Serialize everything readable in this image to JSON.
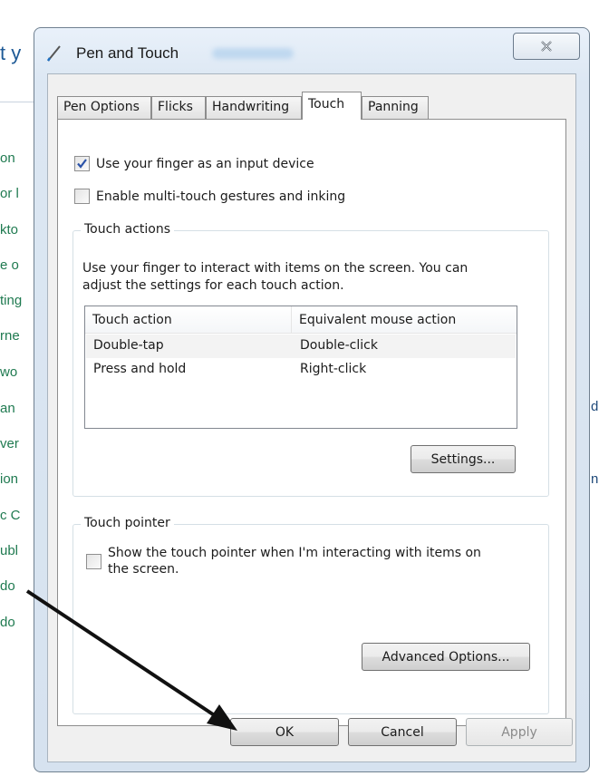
{
  "background": {
    "title_fragment": "t y",
    "links": [
      "on",
      "or l",
      "kto",
      "e o",
      "ting",
      "rne",
      "wo",
      " an",
      "ver",
      "ion",
      "c C",
      "ubl",
      "do",
      "do"
    ],
    "right_fragments": [
      "d",
      "n"
    ]
  },
  "dialog": {
    "title": "Pen and Touch",
    "tabs": [
      {
        "label": "Pen Options",
        "active": false
      },
      {
        "label": "Flicks",
        "active": false
      },
      {
        "label": "Handwriting",
        "active": false
      },
      {
        "label": "Touch",
        "active": true
      },
      {
        "label": "Panning",
        "active": false
      }
    ],
    "checkboxes": {
      "use_finger": {
        "label": "Use your finger as an input device",
        "checked": true
      },
      "multi_touch": {
        "label": "Enable multi-touch gestures and inking",
        "checked": false
      }
    },
    "touch_actions": {
      "group_label": "Touch actions",
      "description": "Use your finger to interact with items on the screen. You can adjust the settings for each touch action.",
      "columns": [
        "Touch action",
        "Equivalent mouse action"
      ],
      "rows": [
        {
          "action": "Double-tap",
          "mouse": "Double-click",
          "selected": true
        },
        {
          "action": "Press and hold",
          "mouse": "Right-click",
          "selected": false
        }
      ],
      "settings_button": "Settings..."
    },
    "touch_pointer": {
      "group_label": "Touch pointer",
      "checkbox_label": "Show the touch pointer when I'm interacting with items on the screen.",
      "checked": false,
      "advanced_button": "Advanced Options..."
    },
    "buttons": {
      "ok": "OK",
      "cancel": "Cancel",
      "apply": "Apply"
    }
  },
  "colors": {
    "link": "#1f7a50",
    "title_blue": "#1e5a96",
    "arrow": "#111111"
  }
}
